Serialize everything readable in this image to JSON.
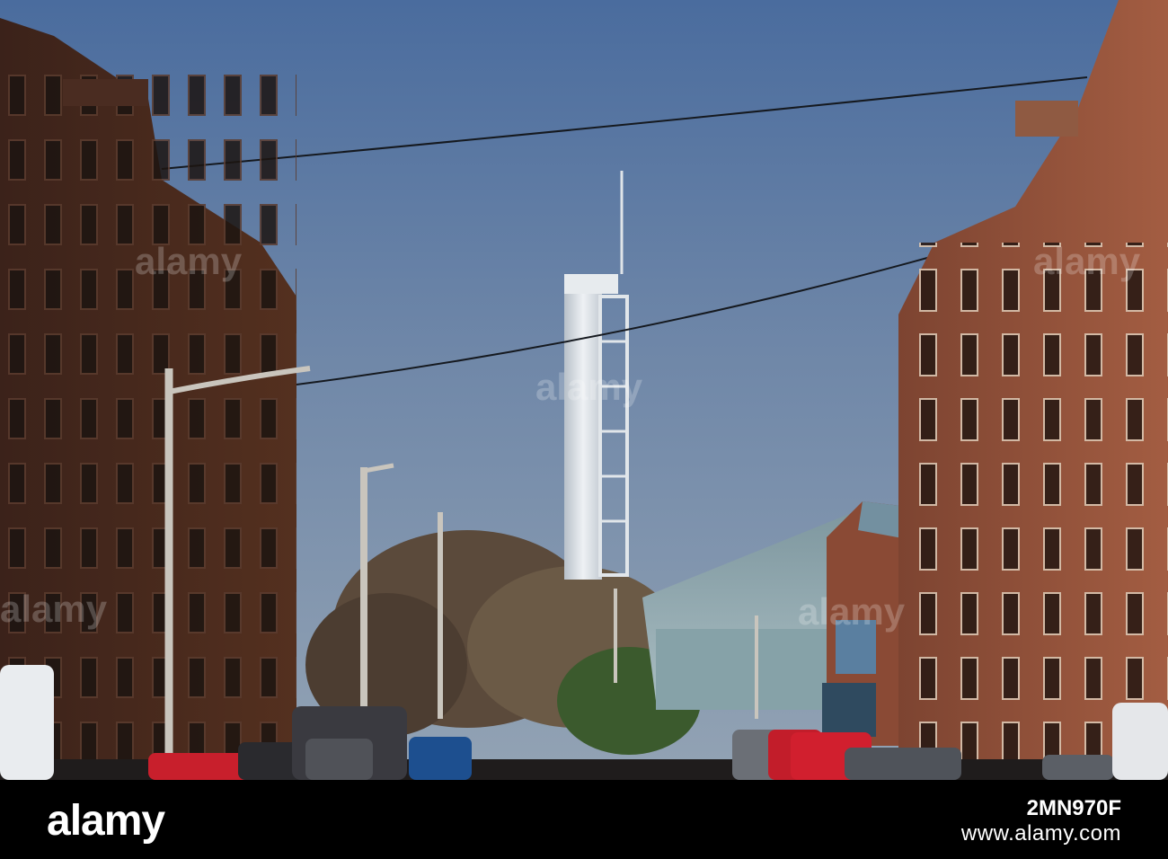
{
  "watermark": {
    "text": "alamy"
  },
  "footer": {
    "brand": "alamy",
    "label": "www.alamy.com",
    "image_id": "2MN970F"
  },
  "colors": {
    "sky_top": "#4a6b9c",
    "sky_bottom": "#8b9fb5",
    "sandstone": "#6b3a2a",
    "tower": "#d8dde3",
    "footer_bg": "#000000"
  }
}
